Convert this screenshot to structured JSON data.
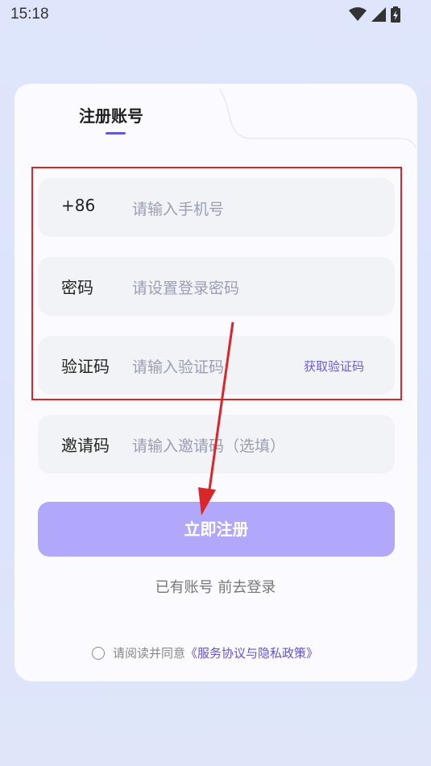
{
  "status_bar": {
    "time": "15:18"
  },
  "tab": {
    "title": "注册账号"
  },
  "fields": [
    {
      "label": "+86",
      "placeholder": "请输入手机号"
    },
    {
      "label": "密码",
      "placeholder": "请设置登录密码"
    },
    {
      "label": "验证码",
      "placeholder": "请输入验证码",
      "action": "获取验证码"
    },
    {
      "label": "邀请码",
      "placeholder": "请输入邀请码（选填）"
    }
  ],
  "register_button": "立即注册",
  "login_link": "已有账号 前去登录",
  "agreement": {
    "prefix": "请阅读并同意",
    "link": "《服务协议与隐私政策》"
  },
  "colors": {
    "accent": "#6358d6",
    "button": "#b1a8fc",
    "highlight_frame": "#d9262b",
    "arrow": "#d9262b"
  }
}
